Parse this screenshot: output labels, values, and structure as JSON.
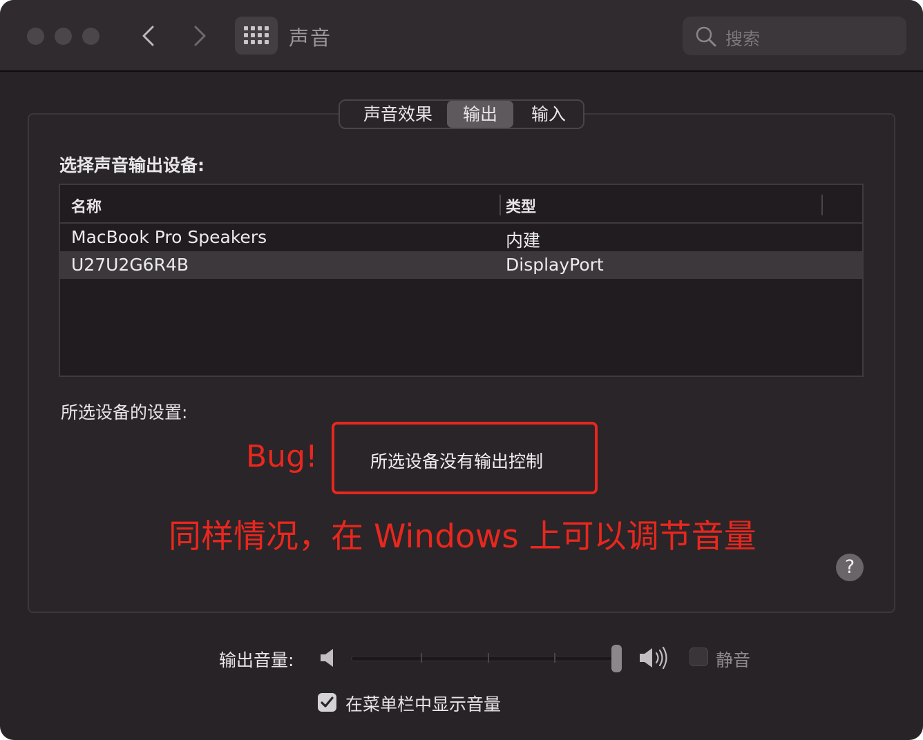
{
  "window": {
    "title": "声音"
  },
  "search": {
    "placeholder": "搜索"
  },
  "tabs": [
    {
      "label": "声音效果",
      "active": false
    },
    {
      "label": "输出",
      "active": true
    },
    {
      "label": "输入",
      "active": false
    }
  ],
  "output": {
    "heading": "选择声音输出设备:",
    "columns": [
      "名称",
      "类型"
    ],
    "rows": [
      {
        "name": "MacBook Pro Speakers",
        "type": "内建",
        "selected": false
      },
      {
        "name": "U27U2G6R4B",
        "type": "DisplayPort",
        "selected": true
      }
    ],
    "settings_label": "所选设备的设置:",
    "no_control_message": "所选设备没有输出控制"
  },
  "annotations": {
    "bug": "Bug!",
    "note": "同样情况，在 Windows 上可以调节音量",
    "color": "#e8271e"
  },
  "help": {
    "label": "?"
  },
  "volume": {
    "label": "输出音量:",
    "level": 1.0,
    "mute_label": "静音",
    "mute_checked": false,
    "show_in_menubar_label": "在菜单栏中显示音量",
    "show_in_menubar_checked": true
  },
  "icons": {
    "traffic_lights": [
      "close-light",
      "minimize-light",
      "zoom-light"
    ],
    "back": "chevron-left-icon",
    "forward": "chevron-right-icon",
    "grid": "grid-icon",
    "search": "search-icon",
    "volume_low": "speaker-low-icon",
    "volume_high": "speaker-high-icon",
    "check": "checkmark-icon"
  }
}
